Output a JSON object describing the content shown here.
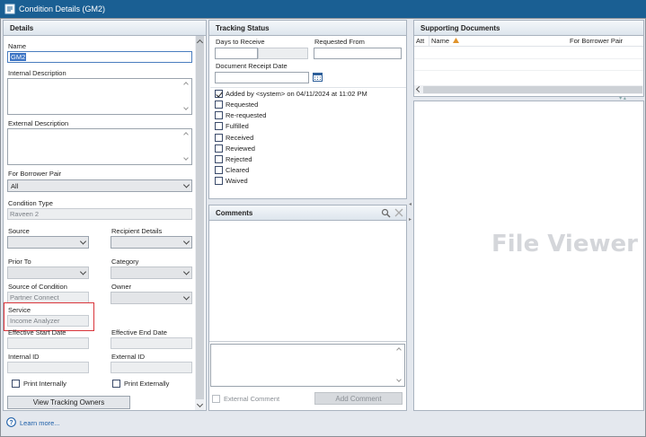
{
  "window": {
    "title": "Condition Details (GM2)"
  },
  "details": {
    "header": "Details",
    "name_label": "Name",
    "name_value": "GM2",
    "internal_desc_label": "Internal Description",
    "external_desc_label": "External Description",
    "borrower_pair_label": "For Borrower Pair",
    "borrower_pair_value": "All",
    "condition_type_label": "Condition Type",
    "condition_type_value": "Raveen 2",
    "source_label": "Source",
    "recipient_label": "Recipient Details",
    "prior_to_label": "Prior To",
    "category_label": "Category",
    "source_condition_label": "Source of Condition",
    "source_condition_value": "Partner Connect",
    "owner_label": "Owner",
    "service_label": "Service",
    "service_value": "Income Analyzer",
    "eff_start_label": "Effective Start Date",
    "eff_end_label": "Effective End Date",
    "internal_id_label": "Internal ID",
    "external_id_label": "External ID",
    "print_internally_label": "Print Internally",
    "print_externally_label": "Print Externally",
    "view_owners_button": "View Tracking Owners",
    "highlight_color": "#d9343a"
  },
  "tracking": {
    "header": "Tracking Status",
    "days_label": "Days to Receive",
    "requested_from_label": "Requested From",
    "receipt_date_label": "Document Receipt Date",
    "statuses": [
      {
        "label": "Added by <system> on 04/11/2024 at 11:02 PM",
        "checked": true
      },
      {
        "label": "Requested",
        "checked": false
      },
      {
        "label": "Re-requested",
        "checked": false
      },
      {
        "label": "Fulfilled",
        "checked": false
      },
      {
        "label": "Received",
        "checked": false
      },
      {
        "label": "Reviewed",
        "checked": false
      },
      {
        "label": "Rejected",
        "checked": false
      },
      {
        "label": "Cleared",
        "checked": false
      },
      {
        "label": "Waived",
        "checked": false
      }
    ]
  },
  "comments": {
    "header": "Comments",
    "external_comment_label": "External Comment",
    "add_comment_button": "Add Comment"
  },
  "supporting": {
    "header": "Supporting Documents",
    "columns": [
      "Att",
      "Name",
      "For Borrower Pair"
    ],
    "sort_color": "#e0932b"
  },
  "viewer": {
    "watermark": "File Viewer"
  },
  "footer": {
    "learn_more": "Learn more..."
  },
  "colors": {
    "titlebar": "#1a5f93",
    "link": "#1d5fa8"
  }
}
